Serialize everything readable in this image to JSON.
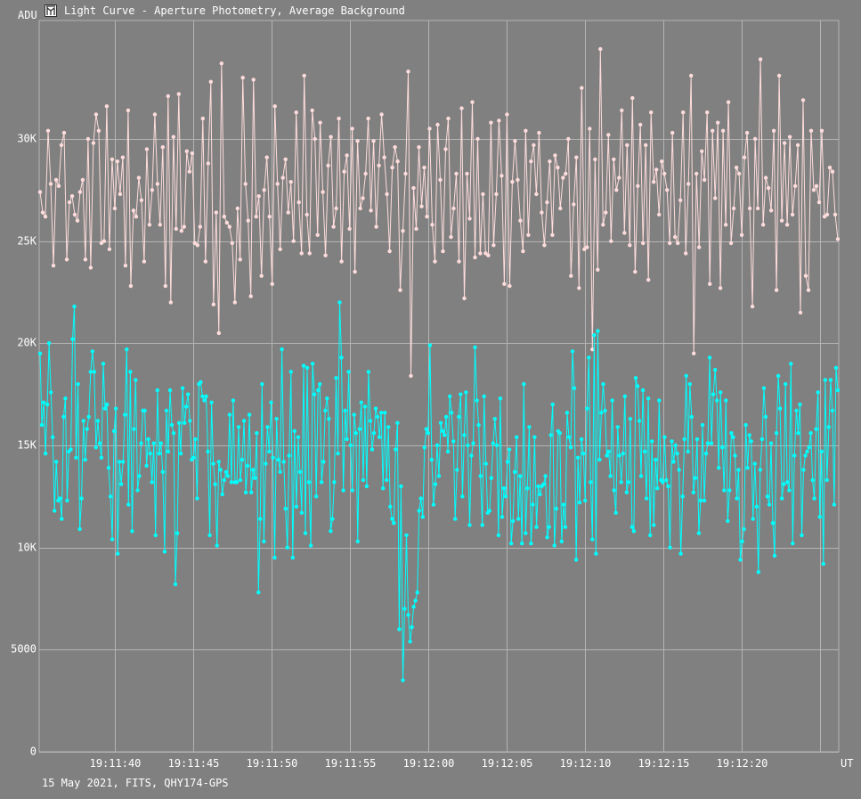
{
  "window": {
    "title": "Light Curve - Aperture Photometry, Average Background",
    "icon": "light-curve-app-icon"
  },
  "footer": "15 May 2021, FITS, QHY174-GPS",
  "colors": {
    "background": "#808080",
    "grid": "#b4b4b4",
    "text": "#ffffff",
    "series_target": "#00ffff",
    "series_comparison": "#ffdcdc"
  },
  "chart_data": {
    "type": "line",
    "title": "Light Curve - Aperture Photometry, Average Background",
    "ylabel": "ADU",
    "xlabel": "UT",
    "ylim": [
      0,
      35800
    ],
    "xlim": [
      "19:11:35.2",
      "19:12:26.2"
    ],
    "yticks": [
      {
        "value": 0,
        "label": "0"
      },
      {
        "value": 5000,
        "label": "5000"
      },
      {
        "value": 10000,
        "label": "10K"
      },
      {
        "value": 15000,
        "label": "15K"
      },
      {
        "value": 20000,
        "label": "20K"
      },
      {
        "value": 25000,
        "label": "25K"
      },
      {
        "value": 30000,
        "label": "30K"
      }
    ],
    "xticks": [
      "19:11:40",
      "19:11:45",
      "19:11:50",
      "19:11:55",
      "19:12:00",
      "19:12:05",
      "19:12:10",
      "19:12:15",
      "19:12:20"
    ],
    "grid": true,
    "markers": true,
    "series": [
      {
        "key": "comparison",
        "values": [
          27400,
          26400,
          26200,
          30400,
          27800,
          23800,
          28000,
          27700,
          29700,
          30300,
          24100,
          26900,
          27200,
          26300,
          26000,
          27400,
          28000,
          24100,
          30000,
          23700,
          29800,
          31200,
          30400,
          24900,
          25000,
          31600,
          24600,
          29000,
          26600,
          28900,
          27300,
          29100,
          23800,
          31400,
          22800,
          26500,
          26200,
          28100,
          27000,
          24000,
          29500,
          25800,
          27500,
          31200,
          27800,
          25800,
          29600,
          22800,
          32100,
          22000,
          30100,
          25600,
          32200,
          25500,
          25700,
          29400,
          28400,
          29300,
          24900,
          24800,
          25700,
          31000,
          24000,
          28800,
          32800,
          21900,
          26400,
          20500,
          33700,
          26200,
          25900,
          25700,
          24900,
          22000,
          26600,
          24100,
          33000,
          27800,
          26000,
          22300,
          32900,
          26200,
          27200,
          23300,
          27500,
          29100,
          26200,
          22900,
          31600,
          27800,
          24600,
          28100,
          29000,
          26400,
          27900,
          25000,
          31300,
          26900,
          24400,
          33100,
          26300,
          24400,
          31400,
          30000,
          25300,
          30800,
          27400,
          24300,
          28700,
          30100,
          25700,
          26600,
          31000,
          24000,
          28400,
          29200,
          25600,
          30500,
          23500,
          29900,
          26600,
          27100,
          28300,
          31000,
          26500,
          29900,
          25700,
          28700,
          31200,
          29100,
          27300,
          24500,
          28600,
          29600,
          28900,
          22600,
          25500,
          28300,
          33300,
          18400,
          27600,
          25600,
          29600,
          26700,
          28600,
          26200,
          30500,
          25800,
          24000,
          30700,
          28000,
          24500,
          29500,
          31000,
          25200,
          26600,
          28300,
          24000,
          31500,
          22200,
          28300,
          26100,
          31800,
          24200,
          30000,
          24400,
          27300,
          24400,
          24300,
          30800,
          24800,
          27300,
          30900,
          28200,
          22900,
          31200,
          22800,
          27900,
          29900,
          28000,
          26000,
          24500,
          30400,
          25300,
          28900,
          29700,
          27300,
          30300,
          26400,
          24800,
          26900,
          28900,
          25300,
          29200,
          28600,
          26600,
          28100,
          28300,
          30000,
          23300,
          26800,
          29100,
          22700,
          32500,
          24600,
          24700,
          30500,
          19700,
          29000,
          23600,
          34400,
          25800,
          26400,
          30200,
          25000,
          29000,
          27500,
          28100,
          31400,
          25400,
          29700,
          24800,
          32000,
          23500,
          27700,
          30700,
          24900,
          29700,
          23100,
          31300,
          27900,
          28500,
          26300,
          28900,
          28300,
          27500,
          24900,
          30300,
          25200,
          24900,
          27000,
          31300,
          24400,
          27800,
          33100,
          19500,
          28300,
          24700,
          29400,
          28000,
          31300,
          22900,
          30400,
          27100,
          30800,
          22700,
          30400,
          25800,
          31800,
          24900,
          26600,
          28600,
          28300,
          25300,
          29100,
          30300,
          26600,
          21800,
          30000,
          26600,
          33900,
          25800,
          28100,
          27600,
          26500,
          30400,
          22600,
          33100,
          26000,
          29800,
          25800,
          30100,
          26300,
          27700,
          29700,
          21500,
          31900,
          23300,
          22600,
          30400,
          27500,
          27700,
          26900,
          30400,
          26200,
          26300,
          28600,
          28400,
          26300,
          25100
        ]
      },
      {
        "key": "target",
        "values": [
          19500,
          16000,
          17100,
          14600,
          17000,
          20000,
          17600,
          15400,
          11800,
          14200,
          12300,
          12400,
          11400,
          16400,
          17300,
          12300,
          14700,
          14800,
          20200,
          21800,
          14400,
          18000,
          10900,
          12400,
          16200,
          14300,
          15800,
          16400,
          18600,
          19600,
          18600,
          14900,
          16200,
          15100,
          14400,
          19000,
          16800,
          17000,
          13900,
          12500,
          10400,
          15700,
          16800,
          9700,
          14200,
          13100,
          14200,
          16500,
          19700,
          12100,
          18600,
          10800,
          15800,
          18200,
          12800,
          13500,
          15100,
          16700,
          16700,
          14000,
          15300,
          14600,
          13200,
          15100,
          10600,
          17700,
          14600,
          15100,
          13700,
          9800,
          16700,
          14700,
          17700,
          16000,
          15600,
          8200,
          10700,
          16100,
          14600,
          17800,
          16100,
          16900,
          17500,
          16200,
          14300,
          14400,
          15300,
          12400,
          18000,
          18100,
          17400,
          17200,
          17400,
          14700,
          10600,
          17100,
          14100,
          13100,
          10100,
          14200,
          13800,
          12600,
          13300,
          13700,
          13500,
          16500,
          13200,
          17200,
          13200,
          13200,
          15900,
          13300,
          14300,
          16200,
          12700,
          14000,
          16500,
          12700,
          13800,
          13400,
          15600,
          7800,
          11400,
          18000,
          10300,
          14100,
          15900,
          14700,
          17100,
          14400,
          9500,
          16300,
          14300,
          13700,
          19700,
          14200,
          11900,
          10000,
          14500,
          18600,
          9500,
          15700,
          12000,
          15400,
          13700,
          11700,
          18900,
          10700,
          18800,
          13200,
          10100,
          19000,
          17500,
          12500,
          17700,
          18000,
          13200,
          14200,
          16700,
          17300,
          16300,
          10800,
          11400,
          13200,
          18300,
          14600,
          22000,
          19300,
          12800,
          16700,
          15300,
          18600,
          15000,
          12800,
          16500,
          15600,
          10300,
          15800,
          17100,
          13300,
          16900,
          13000,
          18600,
          16200,
          14800,
          15600,
          16800,
          16400,
          15400,
          16600,
          12900,
          16600,
          13300,
          15900,
          12000,
          11400,
          11200,
          14800,
          16100,
          6000,
          13000,
          3500,
          7000,
          10600,
          6700,
          5400,
          6100,
          7100,
          7400,
          7800,
          11800,
          12400,
          11500,
          14900,
          15800,
          15600,
          19900,
          14300,
          12100,
          13100,
          15000,
          13500,
          16100,
          15700,
          15500,
          16400,
          14700,
          17400,
          16600,
          15200,
          11400,
          13800,
          16400,
          17500,
          12500,
          15500,
          17600,
          15000,
          11100,
          14500,
          15100,
          19800,
          17200,
          16000,
          13500,
          11100,
          17400,
          14100,
          11700,
          11800,
          13400,
          15100,
          16300,
          15000,
          10600,
          17300,
          11500,
          12900,
          12500,
          14200,
          14800,
          10200,
          11300,
          13700,
          15400,
          11400,
          13500,
          10200,
          18000,
          10700,
          12900,
          15900,
          10200,
          12100,
          15400,
          11000,
          13000,
          12600,
          13000,
          13100,
          13500,
          10500,
          11000,
          15500,
          17000,
          10100,
          11900,
          15700,
          15600,
          10300,
          12100,
          11000,
          16600,
          15400,
          14900,
          19600,
          17800,
          9400,
          14400,
          12200,
          15300,
          14600,
          12300,
          16800,
          19300,
          13200,
          10400,
          20400,
          9700,
          20600,
          14300,
          16600,
          18000,
          16700,
          14500,
          14700,
          13500,
          17200,
          12800,
          11700,
          15900,
          14500,
          13200,
          14600,
          17400,
          12700,
          13200,
          16300,
          11000,
          10800,
          18300,
          17900,
          16200,
          13500,
          17700,
          14700,
          12400,
          17300,
          10600,
          15200,
          11100,
          14300,
          12900,
          17200,
          13300,
          13200,
          15400,
          13300,
          13000,
          10000,
          15200,
          14200,
          15000,
          14600,
          13800,
          9700,
          12500,
          15300,
          18400,
          14700,
          18000,
          16400,
          12700,
          13400,
          15300,
          10700,
          12300,
          16000,
          12300,
          14600,
          15100,
          19300,
          15100,
          17500,
          18700,
          17200,
          13900,
          17600,
          14900,
          12800,
          17200,
          11300,
          12800,
          15600,
          15400,
          14500,
          12400,
          13800,
          9400,
          10300,
          10900,
          16000,
          13900,
          15500,
          15200,
          11400,
          14100,
          12000,
          8800,
          13800,
          15300,
          17800,
          16400,
          12500,
          12100,
          15100,
          11200,
          9600,
          15600,
          18400,
          16800,
          12400,
          13100,
          18000,
          13200,
          12800,
          19000,
          10200,
          14500,
          16700,
          15600,
          17000,
          10600,
          13800,
          14500,
          14700,
          14900,
          15600,
          13300,
          12400,
          15800,
          17600,
          11500,
          14700,
          9200,
          18200,
          13300,
          15900,
          18200,
          16700,
          12100,
          18800,
          17700
        ]
      }
    ]
  }
}
